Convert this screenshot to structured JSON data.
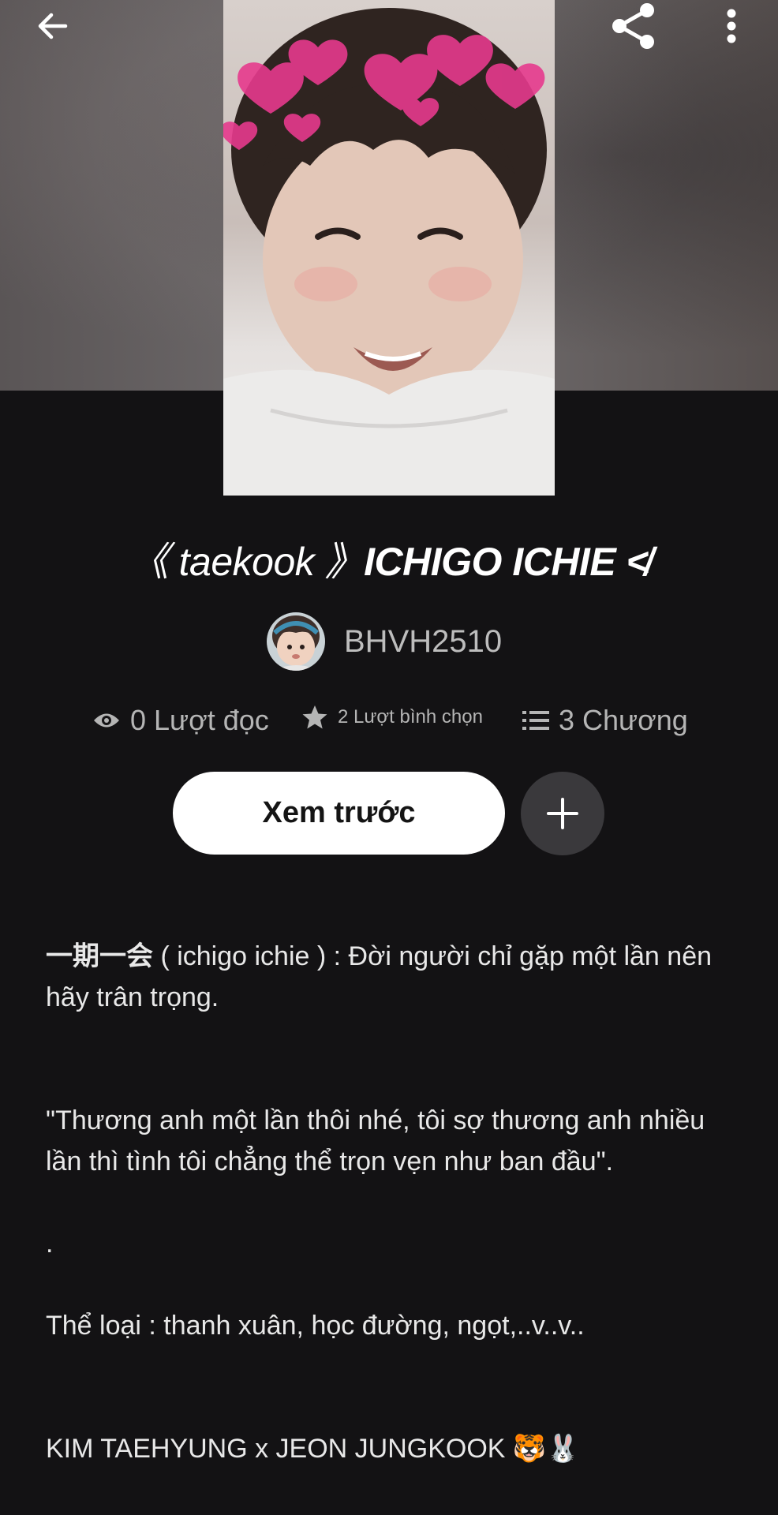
{
  "header": {
    "back_icon": "arrow-left-icon",
    "share_icon": "share-icon",
    "more_icon": "more-vertical-icon"
  },
  "story": {
    "title_part1": "《 taekook 》",
    "title_part2": "ICHIGO ICHIE ≮",
    "author": "BHVH2510",
    "reads": "0 Lượt đọc",
    "votes": "2 Lượt bình chọn",
    "chapters": "3 Chương"
  },
  "actions": {
    "preview_label": "Xem trước",
    "add_icon": "plus-icon"
  },
  "description": {
    "line1": "一期一会 ( ichigo ichie ) : Đời người chỉ gặp một lần nên hãy trân trọng.",
    "line1_bold": "一期一会",
    "line1_rest": " ( ichigo ichie ) : Đời người chỉ gặp một lần nên hãy trân trọng.",
    "quote": "\"Thương anh một lần thôi nhé, tôi sợ thương anh nhiều lần thì tình tôi chẳng thể trọn vẹn như ban đầu\".",
    "dot": ".",
    "genre": "Thể loại : thanh xuân, học đường, ngọt,..v..v..",
    "pairing": "KIM TAEHYUNG x JEON JUNGKOOK 🐯🐰"
  },
  "colors": {
    "background": "#131214",
    "preview_button_bg": "#ffffff",
    "add_button_bg": "#3a393c",
    "stat_text": "#b5b5b5"
  }
}
